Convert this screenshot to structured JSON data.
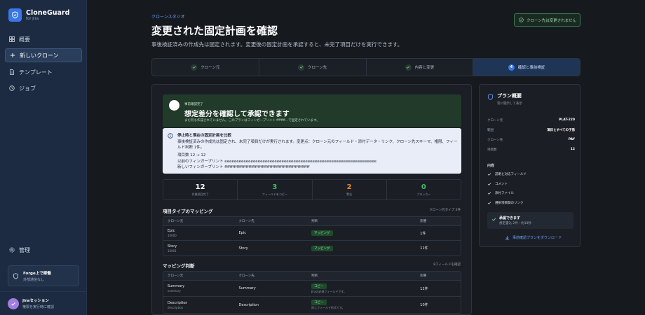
{
  "brand": {
    "title": "CloneGuard",
    "subtitle": "for Jira"
  },
  "nav": [
    {
      "label": "概要"
    },
    {
      "label": "新しいクローン"
    },
    {
      "label": "テンプレート"
    },
    {
      "label": "ジョブ"
    }
  ],
  "admin": {
    "label": "管理"
  },
  "forge": {
    "title": "Forge上で稼働",
    "sub": "外部通信なし"
  },
  "session": {
    "title": "Jiraセッション",
    "sub": "権限を実行時に確認"
  },
  "header": {
    "eyebrow": "クローンスタジオ",
    "title": "変更された固定計画を確認",
    "subtitle": "事後検証済みの作成先は固定されます。変更後の固定計画を承認すると、未完了項目だけを実行できます。",
    "badge": "クローン先は変更されません"
  },
  "steps": [
    {
      "label": "クローン元",
      "done": true
    },
    {
      "label": "クローン先",
      "done": true
    },
    {
      "label": "内容と変更",
      "done": true
    },
    {
      "label": "確認と事前検証",
      "num": "4",
      "current": true
    }
  ],
  "banner": {
    "eyebrow": "事前確認完了",
    "title": "想定差分を確認して承認できます",
    "sub": "まだ何も作成されていません。このプランはフィンガープリント ffffffff…で固定されています。"
  },
  "notice": {
    "title": "停止時と現在の固定計画を比較",
    "text": "事後検証済みの作成先は固定され、未完了項目だけが実行されます。変更点：クローン元のフィールド・添付データ・リンク、クローン先スキーマ、権限、フィールド判断 1件。",
    "line1": "項目数 12 → 12",
    "line2": "以前のフィンガープリント eeeeeeeeeeeeeeeeeeeeeeeeeeeeeeeeeeeeeeeeeeeeeeeeeeeeeeeeeeeeeeee",
    "line3": "新しいフィンガープリント ffffffffffffffffffffffffffffffffffffffffffffffffffffffffffffffff"
  },
  "stats": [
    {
      "value": "12",
      "label": "作業項目完了",
      "color": "#ffffff"
    },
    {
      "value": "3",
      "label": "フィールドをコピー",
      "color": "#3fb96b"
    },
    {
      "value": "2",
      "label": "警告",
      "color": "#e8893a"
    },
    {
      "value": "0",
      "label": "ブロッカー",
      "color": "#3fb96b"
    }
  ],
  "mapping_types": {
    "title": "項目タイプのマッピング",
    "note": "クローン元タイプ 2件",
    "headers": [
      "クローン元",
      "クローン先",
      "判断",
      "影響"
    ],
    "rows": [
      {
        "src": "Epic",
        "src_id": "10000",
        "dst": "Epic",
        "decision": "マッピング",
        "impact": "1件"
      },
      {
        "src": "Story",
        "src_id": "10001",
        "dst": "Story",
        "decision": "マッピング",
        "impact": "11件"
      }
    ]
  },
  "mapping_fields": {
    "title": "マッピング判断",
    "note": "8フィールドを確認",
    "headers": [
      "クローン元",
      "クローン先",
      "判断",
      "影響"
    ],
    "rows": [
      {
        "src": "Summary",
        "src_id": "summary",
        "dst": "Summary",
        "decision": "コピー",
        "decision_sub": "Jiraの必須フィールドです。",
        "impact": "12件"
      },
      {
        "src": "Description",
        "src_id": "description",
        "dst": "Description",
        "decision": "コピー",
        "decision_sub": "同じフィールド形式です。",
        "impact": "10件"
      }
    ]
  },
  "summary": {
    "title": "プラン概要",
    "sub": "常に開示して表示",
    "kv": [
      {
        "k": "クローン元",
        "v": "PLAT-220"
      },
      {
        "k": "範囲",
        "v": "項目とすべての子孫"
      },
      {
        "k": "クローン先",
        "v": "PAY"
      },
      {
        "k": "項目数",
        "v": "12"
      }
    ],
    "content_title": "内容",
    "content": [
      "説明と対応フィールド",
      "コメント",
      "添付ファイル",
      "選択項目間のリンク"
    ],
    "ready_title": "承認できます",
    "ready_sub": "想定書込 2件・約18秒",
    "download": "事前確認プランをダウンロード"
  }
}
